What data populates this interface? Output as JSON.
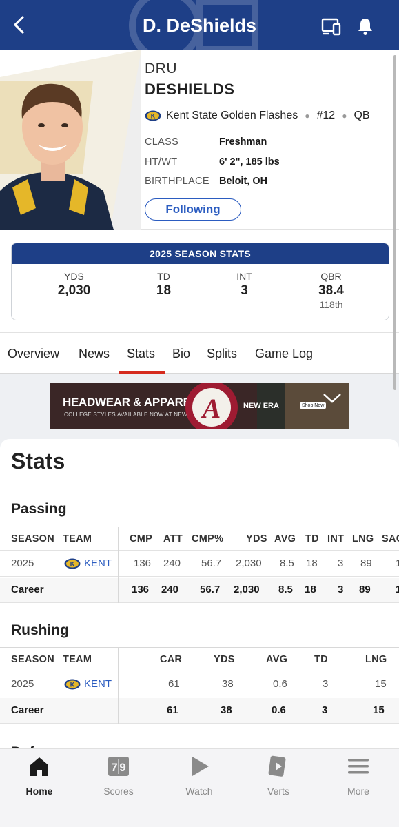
{
  "header": {
    "title": "D. DeShields",
    "back_icon": "chevron-left-icon",
    "cast_icon": "cast-icon",
    "bell_icon": "bell-icon",
    "bg_color": "#1e3f87"
  },
  "player": {
    "first_name": "DRU",
    "last_name": "DESHIELDS",
    "team": "Kent State Golden Flashes",
    "number": "#12",
    "position": "QB",
    "bio": [
      {
        "label": "CLASS",
        "value": "Freshman"
      },
      {
        "label": "HT/WT",
        "value": "6' 2\", 185 lbs"
      },
      {
        "label": "BIRTHPLACE",
        "value": "Beloit, OH"
      }
    ],
    "follow_label": "Following"
  },
  "season_stats": {
    "title": "2025 SEASON STATS",
    "items": [
      {
        "label": "YDS",
        "value": "2,030",
        "rank": ""
      },
      {
        "label": "TD",
        "value": "18",
        "rank": ""
      },
      {
        "label": "INT",
        "value": "3",
        "rank": ""
      },
      {
        "label": "QBR",
        "value": "38.4",
        "rank": "118th"
      }
    ]
  },
  "tabs": [
    "Overview",
    "News",
    "Stats",
    "Bio",
    "Splits",
    "Game Log"
  ],
  "active_tab": "Stats",
  "ad": {
    "headline": "HEADWEAR & APPAREL",
    "subline": "COLLEGE STYLES AVAILABLE NOW AT NEWERA",
    "brand": "NEW ERA",
    "cta": "Shop Now"
  },
  "stats": {
    "title": "Stats",
    "passing": {
      "title": "Passing",
      "columns": [
        "SEASON",
        "TEAM",
        "CMP",
        "ATT",
        "CMP%",
        "YDS",
        "AVG",
        "TD",
        "INT",
        "LNG",
        "SACK"
      ],
      "rows": [
        [
          "2025",
          "KENT",
          "136",
          "240",
          "56.7",
          "2,030",
          "8.5",
          "18",
          "3",
          "89",
          "1"
        ],
        [
          "Career",
          "",
          "136",
          "240",
          "56.7",
          "2,030",
          "8.5",
          "18",
          "3",
          "89",
          "1"
        ]
      ]
    },
    "rushing": {
      "title": "Rushing",
      "columns": [
        "SEASON",
        "TEAM",
        "CAR",
        "YDS",
        "AVG",
        "TD",
        "LNG"
      ],
      "rows": [
        [
          "2025",
          "KENT",
          "61",
          "38",
          "0.6",
          "3",
          "15"
        ],
        [
          "Career",
          "",
          "61",
          "38",
          "0.6",
          "3",
          "15"
        ]
      ]
    },
    "next_section": "Defense"
  },
  "bottom_nav": [
    {
      "label": "Home",
      "icon": "home-icon",
      "active": true
    },
    {
      "label": "Scores",
      "icon": "scoreboard-icon",
      "active": false
    },
    {
      "label": "Watch",
      "icon": "play-icon",
      "active": false
    },
    {
      "label": "Verts",
      "icon": "verts-icon",
      "active": false
    },
    {
      "label": "More",
      "icon": "menu-icon",
      "active": false
    }
  ]
}
